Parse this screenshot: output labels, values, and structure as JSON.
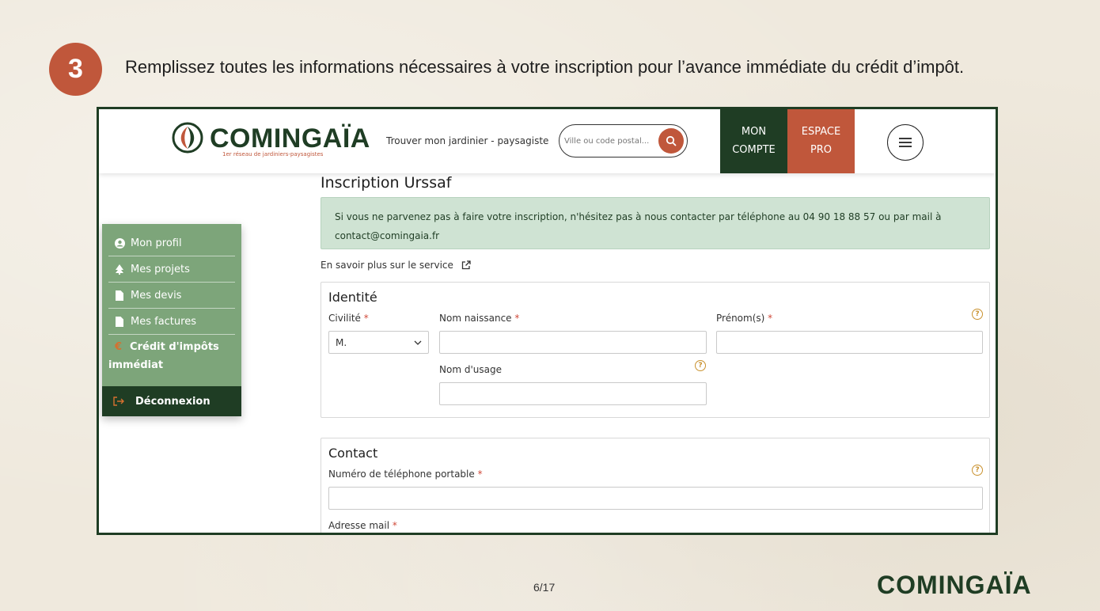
{
  "step": {
    "number": "3",
    "instruction": "Remplissez toutes les informations nécessaires à votre inscription pour l’avance immédiate du crédit d’impôt."
  },
  "header": {
    "logo_text": "COMINGAÏA",
    "logo_tagline": "1er réseau de jardiniers-paysagistes",
    "find_label": "Trouver mon jardinier - paysagiste",
    "search_placeholder": "Ville ou code postal...",
    "account_line1": "MON",
    "account_line2": "COMPTE",
    "pro_line1": "ESPACE",
    "pro_line2": "PRO"
  },
  "sidebar": {
    "items": [
      {
        "label": "Mon profil",
        "icon": "user-icon"
      },
      {
        "label": "Mes projets",
        "icon": "tree-icon"
      },
      {
        "label": "Mes devis",
        "icon": "file-icon"
      },
      {
        "label": "Mes factures",
        "icon": "file-icon"
      }
    ],
    "credit_label_1": "Crédit d'impôts",
    "credit_label_2": "immédiat",
    "credit_icon": "€",
    "logout_label": "Déconnexion"
  },
  "main": {
    "title": "Inscription Urssaf",
    "alert_line1": "Si vous ne parvenez pas à faire votre inscription, n'hésitez pas à nous contacter par téléphone au 04 90 18 88 57 ou par mail à",
    "alert_line2": "contact@comingaia.fr",
    "learn_more": "En savoir plus sur le service",
    "identity": {
      "title": "Identité",
      "civility_label": "Civilité",
      "civility_value": "M.",
      "birth_name_label": "Nom naissance",
      "first_name_label": "Prénom(s)",
      "usage_name_label": "Nom d'usage",
      "birth_name_value": "",
      "first_name_value": "",
      "usage_name_value": ""
    },
    "contact": {
      "title": "Contact",
      "phone_label": "Numéro de téléphone portable",
      "phone_value": "",
      "email_label": "Adresse mail"
    },
    "required_mark": "*",
    "help_mark": "?"
  },
  "footer": {
    "page": "6/17",
    "logo_text": "COMINGAÏA"
  },
  "colors": {
    "brand_green": "#1f3d24",
    "brand_terracotta": "#c0573b",
    "sidebar_green": "#7da57a",
    "alert_bg": "#cfe3d3"
  }
}
